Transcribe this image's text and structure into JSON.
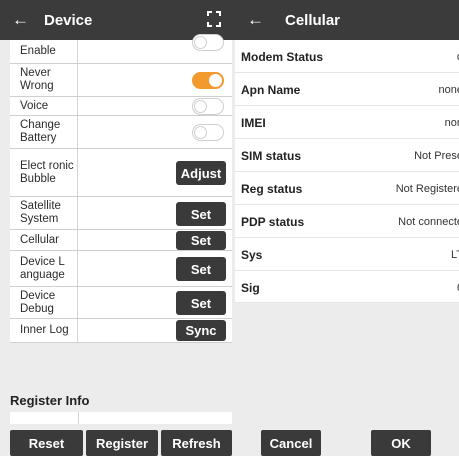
{
  "device_screen": {
    "title": "Device",
    "rows": [
      {
        "label": "Enable"
      },
      {
        "label": "Never Wrong"
      },
      {
        "label": "Voice"
      },
      {
        "label": "Change Battery"
      },
      {
        "label": "Elect ronic Bubble",
        "button": "Adjust"
      },
      {
        "label": "Satellite System",
        "button": "Set"
      },
      {
        "label": "Cellular",
        "button": "Set"
      },
      {
        "label": "Device L anguage",
        "button": "Set"
      },
      {
        "label": "Device Debug",
        "button": "Set"
      },
      {
        "label": "Inner Log",
        "button": "Sync"
      }
    ],
    "toggles": {
      "enable": false,
      "never_wrong": true,
      "voice": false,
      "change_battery": false
    },
    "register_info_title": "Register Info",
    "footer": {
      "reset": "Reset",
      "register": "Register",
      "refresh": "Refresh"
    }
  },
  "cellular_screen": {
    "title": "Cellular",
    "rows": [
      {
        "key": "Modem Status",
        "value": "o"
      },
      {
        "key": "Apn Name",
        "value": "none"
      },
      {
        "key": "IMEI",
        "value": "non"
      },
      {
        "key": "SIM status",
        "value": "Not Prese"
      },
      {
        "key": "Reg status",
        "value": "Not Registere"
      },
      {
        "key": "PDP status",
        "value": "Not connecte"
      },
      {
        "key": "Sys",
        "value": "LT"
      },
      {
        "key": "Sig",
        "value": "6"
      }
    ],
    "footer": {
      "cancel": "Cancel",
      "ok": "OK"
    }
  },
  "colors": {
    "appbar": "#3b3b3b",
    "toggle_on": "#f29a2e",
    "button": "#3a3a3a",
    "background": "#ececec"
  },
  "icons": {
    "back": "arrow-left",
    "expand": "expand-corners"
  }
}
